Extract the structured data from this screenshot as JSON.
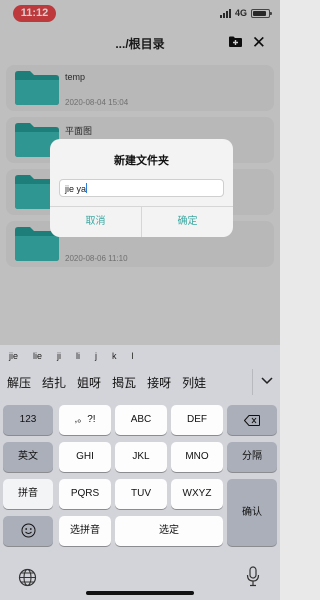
{
  "status": {
    "time": "11:12",
    "network": "4G"
  },
  "nav": {
    "title": ".../根目录"
  },
  "files": [
    {
      "name": "temp",
      "date": "2020-08-04 15:04"
    },
    {
      "name": "平面图",
      "date": ""
    },
    {
      "name": "",
      "date": ""
    },
    {
      "name": "",
      "date": "2020-08-06 11:10"
    }
  ],
  "dialog": {
    "title": "新建文件夹",
    "input_value": "jie ya",
    "cancel_label": "取消",
    "ok_label": "确定"
  },
  "keyboard": {
    "pinyin": [
      "jie",
      "lie",
      "ji",
      "li",
      "j",
      "k",
      "l"
    ],
    "candidates": [
      "解压",
      "结扎",
      "姐呀",
      "揭瓦",
      "接呀",
      "列娃"
    ],
    "keys": {
      "k123": "123",
      "punct": ",。?!",
      "abc": "ABC",
      "def": "DEF",
      "english": "英文",
      "ghi": "GHI",
      "jkl": "JKL",
      "mno": "MNO",
      "fenci": "分隔",
      "pinyin": "拼音",
      "pqrs": "PQRS",
      "tuv": "TUV",
      "wxyz": "WXYZ",
      "confirm": "确认",
      "choose_pinyin": "选拼音",
      "choose": "选定"
    }
  }
}
